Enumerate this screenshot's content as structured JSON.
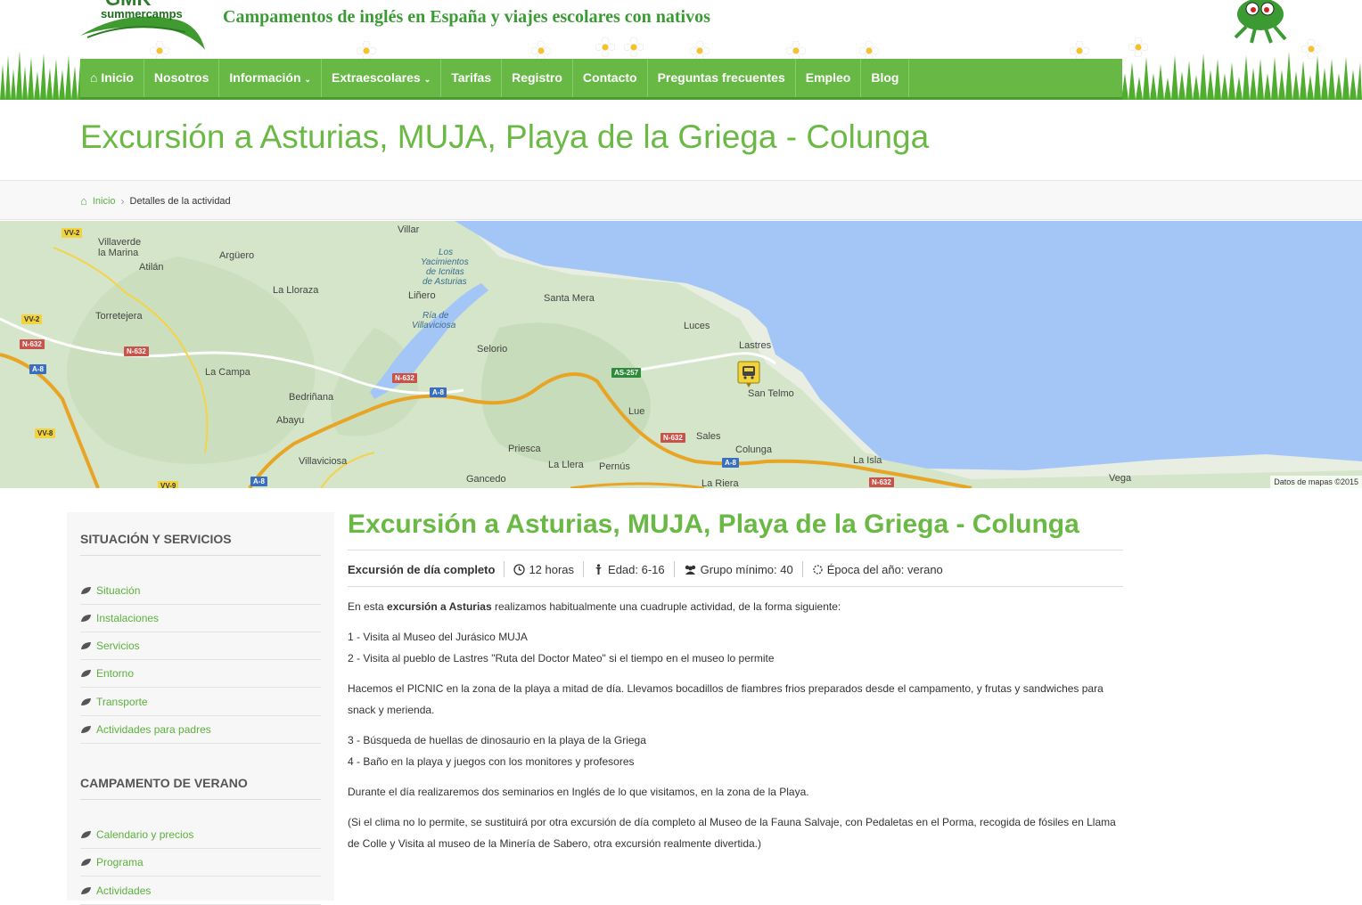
{
  "header": {
    "logo_big": "GMK",
    "logo_small": "summercamps",
    "tagline": "Campamentos de inglés en España y viajes escolares con nativos"
  },
  "nav": {
    "items": [
      {
        "label": "Inicio",
        "icon": "home-icon"
      },
      {
        "label": "Nosotros"
      },
      {
        "label": "Información",
        "dropdown": true
      },
      {
        "label": "Extraescolares",
        "dropdown": true
      },
      {
        "label": "Tarifas"
      },
      {
        "label": "Registro"
      },
      {
        "label": "Contacto"
      },
      {
        "label": "Preguntas frecuentes"
      },
      {
        "label": "Empleo"
      },
      {
        "label": "Blog"
      }
    ]
  },
  "page_title": "Excursión a Asturias, MUJA, Playa de la Griega - Colunga",
  "breadcrumb": {
    "home": "Inicio",
    "current": "Detalles de la actividad"
  },
  "map": {
    "labels": {
      "villaverde": "Villaverde",
      "la_marina": "la Marina",
      "atilan": "Atilán",
      "arguero": "Argüero",
      "villar": "Villar",
      "los": "Los",
      "yacimientos": "Yacimientos",
      "de_icnitas": "de Icnitas",
      "de_asturias": "de Asturias",
      "la_lloraza": "La Lloraza",
      "linero": "Liñero",
      "ria_de": "Ría de",
      "villaviciosa_ria": "Villaviciosa",
      "santa_mera": "Santa Mera",
      "torretejera": "Torretejera",
      "selorio": "Selorio",
      "luces": "Luces",
      "lastres": "Lastres",
      "la_campa": "La Campa",
      "bedrinana": "Bedriñana",
      "san_telmo": "San Telmo",
      "lue": "Lue",
      "abayu": "Abayu",
      "sales": "Sales",
      "priesca": "Priesca",
      "colunga": "Colunga",
      "villaviciosa": "Villaviciosa",
      "la_llera": "La Llera",
      "pernus": "Pernús",
      "la_isla": "La Isla",
      "gancedo": "Gancedo",
      "la_riera": "La Riera",
      "vega": "Vega"
    },
    "shields": {
      "vv2a": "VV-2",
      "vv2b": "VV-2",
      "n632a": "N-632",
      "n632b": "N-632",
      "a8a": "A-8",
      "n632c": "N-632",
      "a8b": "A-8",
      "as257": "AS-257",
      "vv8": "VV-8",
      "n632d": "N-632",
      "a8c": "A-8",
      "a8d": "A-8",
      "vv9": "VV-9",
      "n632e": "N-632"
    },
    "copyright": "Datos de mapas ©2015"
  },
  "sidebar": {
    "section1_title": "SITUACIÓN Y SERVICIOS",
    "section1_items": [
      "Situación",
      "Instalaciones",
      "Servicios",
      "Entorno",
      "Transporte",
      "Actividades para padres"
    ],
    "section2_title": "CAMPAMENTO DE VERANO",
    "section2_items": [
      "Calendario y precios",
      "Programa",
      "Actividades"
    ]
  },
  "content": {
    "title": "Excursión a Asturias, MUJA, Playa de la Griega - Colunga",
    "meta": {
      "type": "Excursión de día completo",
      "duration": "12 horas",
      "age": "Edad: 6-16",
      "group": "Grupo mínimo: 40",
      "season": "Época del año: verano"
    },
    "intro_pre": "En esta ",
    "intro_bold": "excursión a Asturias",
    "intro_post": " realizamos habitualmente una cuadruple actividad, de la forma siguiente:",
    "step1": "1 - Visita al Museo del Jurásico MUJA",
    "step2": "2 - Visita al pueblo de Lastres \"Ruta del Doctor Mateo\" si el tiempo en el museo lo permite",
    "picnic": "Hacemos el PICNIC en la zona de la playa a mitad de día. Llevamos bocadillos de fiambres frios preparados desde el campamento, y frutas y sandwiches para snack y merienda.",
    "step3": "3 - Búsqueda de huellas de dinosaurio en la playa de la Griega",
    "step4": "4 - Baño en la playa y juegos con los monitores y profesores",
    "seminars": "Durante el día realizaremos dos seminarios en Inglés de lo que visitamos, en la zona de la Playa.",
    "alternative": "(Si el clima no lo permite, se sustituirá por otra excursión de día completo al Museo de la Fauna Salvaje, con Pedaletas en el Porma, recogida de fósiles en Llama de Colle y Visita al museo de la Minería de Sabero, otra excursión realmente divertida.)"
  },
  "colors": {
    "brand_green": "#67b845",
    "title_green": "#6ab944",
    "link_green": "#5cb13b",
    "sea_blue": "#a4c6f6"
  }
}
